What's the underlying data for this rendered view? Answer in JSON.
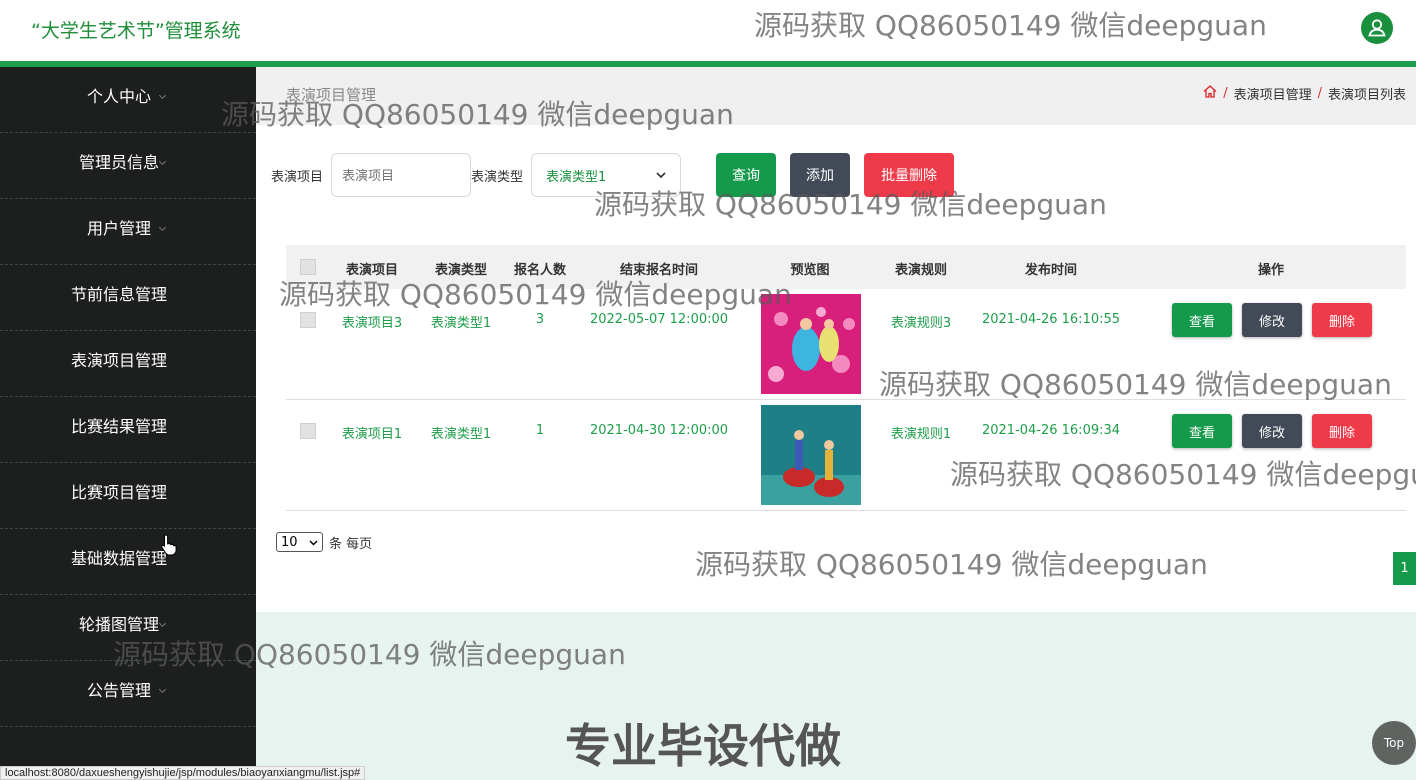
{
  "header": {
    "title": "“大学生艺术节”管理系统",
    "avatar_icon": "user-icon"
  },
  "sidebar": {
    "items": [
      {
        "label": "个人中心"
      },
      {
        "label": "管理员信息"
      },
      {
        "label": "用户管理"
      },
      {
        "label": "节前信息管理"
      },
      {
        "label": "表演项目管理"
      },
      {
        "label": "比赛结果管理"
      },
      {
        "label": "比赛项目管理"
      },
      {
        "label": "基础数据管理"
      },
      {
        "label": "轮播图管理"
      },
      {
        "label": "公告管理"
      }
    ]
  },
  "page": {
    "title": "表演项目管理",
    "breadcrumb": [
      "表演项目管理",
      "表演项目列表"
    ]
  },
  "filters": {
    "project_label": "表演项目",
    "project_placeholder": "表演项目",
    "type_label": "表演类型",
    "type_value": "表演类型1",
    "search_button": "查询",
    "add_button": "添加",
    "batch_delete_button": "批量删除"
  },
  "table": {
    "headers": [
      "表演项目",
      "表演类型",
      "报名人数",
      "结束报名时间",
      "预览图",
      "表演规则",
      "发布时间",
      "操作"
    ],
    "rows": [
      {
        "project": "表演项目3",
        "type": "表演类型1",
        "count": "3",
        "end_time": "2022-05-07 12:00:00",
        "rule": "表演规则3",
        "publish_time": "2021-04-26 16:10:55"
      },
      {
        "project": "表演项目1",
        "type": "表演类型1",
        "count": "1",
        "end_time": "2021-04-30 12:00:00",
        "rule": "表演规则1",
        "publish_time": "2021-04-26 16:09:34"
      }
    ],
    "actions": {
      "view": "查看",
      "edit": "修改",
      "delete": "删除"
    }
  },
  "pagination": {
    "page_size": "10",
    "suffix": "条 每页",
    "current_page": "1"
  },
  "overlays": {
    "watermark": "源码获取 QQ86050149 微信deepguan",
    "promo": "专业毕设代做"
  },
  "status_url": "localhost:8080/daxueshengyishujie/jsp/modules/biaoyanxiangmu/list.jsp#",
  "back_to_top": "Top",
  "colors": {
    "accent": "#1e9e4a",
    "sidebar_bg": "#1c1f1d",
    "danger": "#ef3a4a",
    "neutral_button": "#424a58"
  }
}
